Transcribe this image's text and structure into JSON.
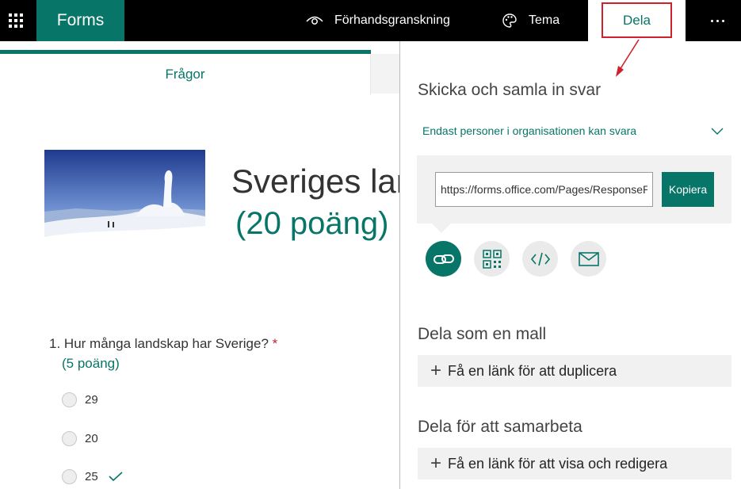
{
  "topbar": {
    "app_name": "Forms",
    "preview_label": "Förhandsgranskning",
    "theme_label": "Tema",
    "share_label": "Dela"
  },
  "tabs": {
    "questions": "Frågor"
  },
  "form": {
    "title": "Sveriges landskap",
    "points": "(20 poäng)"
  },
  "question": {
    "number": "1.",
    "text": "Hur många landskap har Sverige?",
    "required_marker": "*",
    "points": "(5 poäng)",
    "options": [
      "29",
      "20",
      "25"
    ]
  },
  "share_panel": {
    "heading": "Skicka och samla in svar",
    "audience": "Endast personer i organisationen kan svara",
    "link_value": "https://forms.office.com/Pages/ResponsePage.aspx",
    "copy_label": "Kopiera",
    "icons": [
      "link-icon",
      "qr-code-icon",
      "embed-icon",
      "email-icon"
    ],
    "template_heading": "Dela som en mall",
    "template_action": "Få en länk för att duplicera",
    "collab_heading": "Dela för att samarbeta",
    "collab_action": "Få en länk för att visa och redigera"
  },
  "colors": {
    "brand": "#077568",
    "annotation": "#d0202a"
  }
}
